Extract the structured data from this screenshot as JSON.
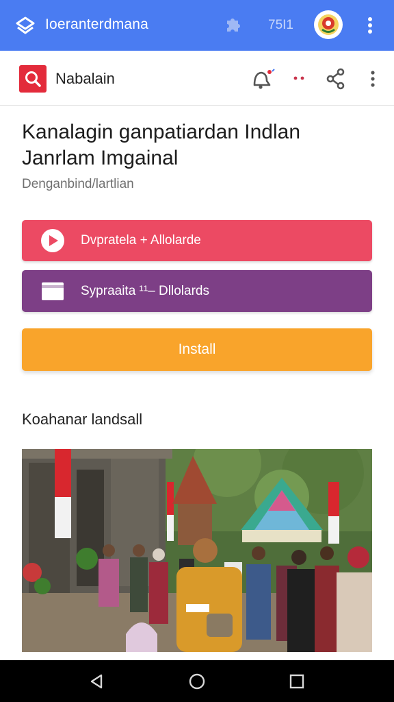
{
  "app_bar": {
    "title": "Ioeranterdmana",
    "count": "75I1",
    "logo_icon": "layers-logo-icon",
    "extension_icon": "puzzle-icon",
    "avatar": "emblem-avatar",
    "menu_icon": "kebab-menu-icon",
    "color": "#4a7cf2"
  },
  "toolbar": {
    "page_name": "Nabalain",
    "search_icon": "search-icon",
    "icons": [
      "notification-bell-icon",
      "dots-icon",
      "share-icon",
      "more-vert-icon"
    ]
  },
  "article": {
    "headline_line1": "Kanalagin ganpatiardan Indlan",
    "headline_line2": "Janrlam Imgainal",
    "subtitle": "Denganbind/lartlian"
  },
  "actions": {
    "primary_label": "Dvpratela + Allolarde",
    "primary_icon": "play-circle-icon",
    "primary_color": "#ec4a63",
    "secondary_label": "Sypraaita ¹¹– Dllolards",
    "secondary_icon": "card-icon",
    "secondary_color": "#7d3f86",
    "install_label": "Install",
    "install_color": "#f9a42b"
  },
  "section": {
    "title": "Koahanar landsall"
  },
  "navigation": {
    "back_icon": "back-triangle-icon",
    "home_icon": "home-circle-icon",
    "recents_icon": "recents-square-icon"
  }
}
